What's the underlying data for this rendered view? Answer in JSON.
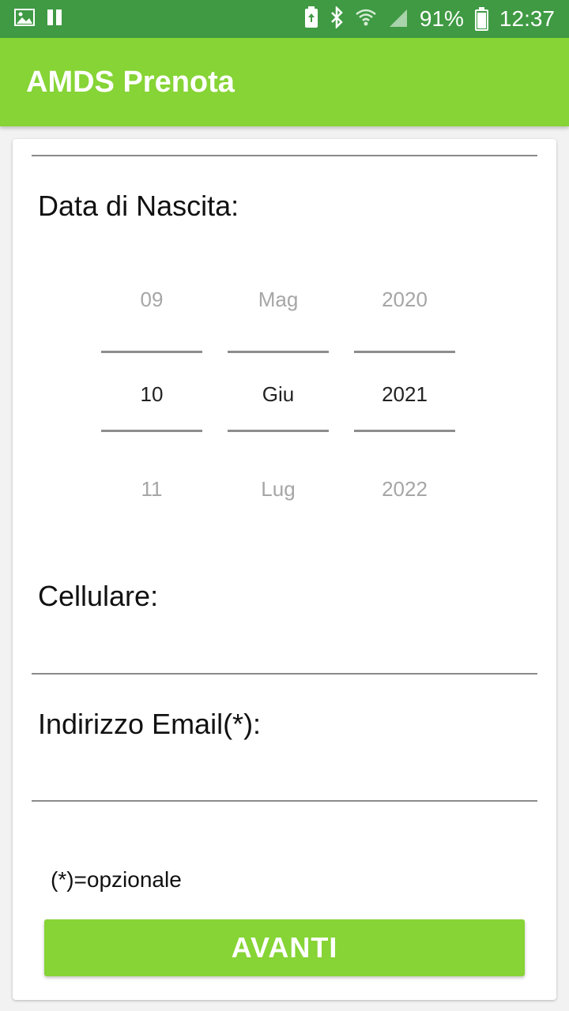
{
  "status_bar": {
    "battery_percent": "91%",
    "time": "12:37",
    "icons": [
      "image-icon",
      "pause-icon",
      "battery-saver-icon",
      "bluetooth-icon",
      "wifi-icon",
      "signal-icon",
      "battery-icon"
    ]
  },
  "app_bar": {
    "title": "AMDS Prenota"
  },
  "form": {
    "birth_date_label": "Data di Nascita:",
    "date_picker": {
      "day": {
        "prev": "09",
        "selected": "10",
        "next": "11"
      },
      "month": {
        "prev": "Mag",
        "selected": "Giu",
        "next": "Lug"
      },
      "year": {
        "prev": "2020",
        "selected": "2021",
        "next": "2022"
      }
    },
    "mobile_label": "Cellulare:",
    "mobile_value": "",
    "email_label": "Indirizzo Email(*):",
    "email_value": "",
    "optional_note": "(*)=opzionale",
    "next_button_label": "AVANTI"
  },
  "colors": {
    "status_bar": "#3f9a43",
    "app_bar": "#86d435",
    "button": "#86d435"
  }
}
